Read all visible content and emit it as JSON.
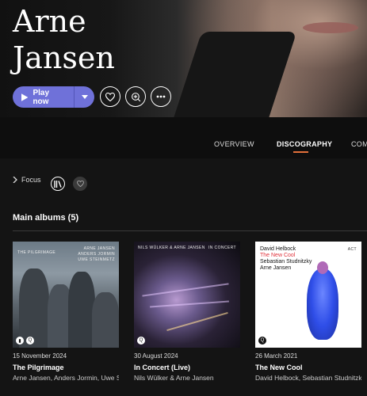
{
  "artist": {
    "name_line1": "Arne",
    "name_line2": "Jansen"
  },
  "actions": {
    "play_label": "Play now",
    "play_dropdown_icon": "caret-down-icon",
    "favorite_icon": "heart-icon",
    "add_icon": "add-to-library-icon",
    "more_icon": "more-horizontal-icon"
  },
  "tabs": [
    {
      "label": "OVERVIEW",
      "active": false
    },
    {
      "label": "DISCOGRAPHY",
      "active": true
    },
    {
      "label": "COM",
      "active": false
    }
  ],
  "filters": {
    "focus_label": "Focus"
  },
  "section": {
    "title": "Main albums (5)"
  },
  "albums": [
    {
      "date": "15 November 2024",
      "title": "The Pilgrimage",
      "artists": "Arne Jansen, Anders Jormin, Uwe Steinmetz",
      "cover_top_left": "THE PILGRIMAGE",
      "cover_top_right_1": "ARNE JANSEN",
      "cover_top_right_2": "ANDERS JORMIN",
      "cover_top_right_3": "UWE STEINMETZ"
    },
    {
      "date": "30 August 2024",
      "title": "In Concert (Live)",
      "artists": "Nils Wülker & Arne Jansen",
      "cover_top_left": "NILS WÜLKER & ARNE JANSEN",
      "cover_top_right_1": "IN CONCERT"
    },
    {
      "date": "26 March 2021",
      "title": "The New Cool",
      "artists": "David Helbock, Sebastian Studnitzky",
      "cover_line_1": "David Helbock",
      "cover_line_2": "The New Cool",
      "cover_line_3": "Sebastian Studnitzky",
      "cover_line_4": "Arne Jansen",
      "cover_label": "ACT"
    }
  ],
  "colors": {
    "accent": "#6f71d9",
    "tab_underline": "#e2703a",
    "background": "#141414"
  }
}
